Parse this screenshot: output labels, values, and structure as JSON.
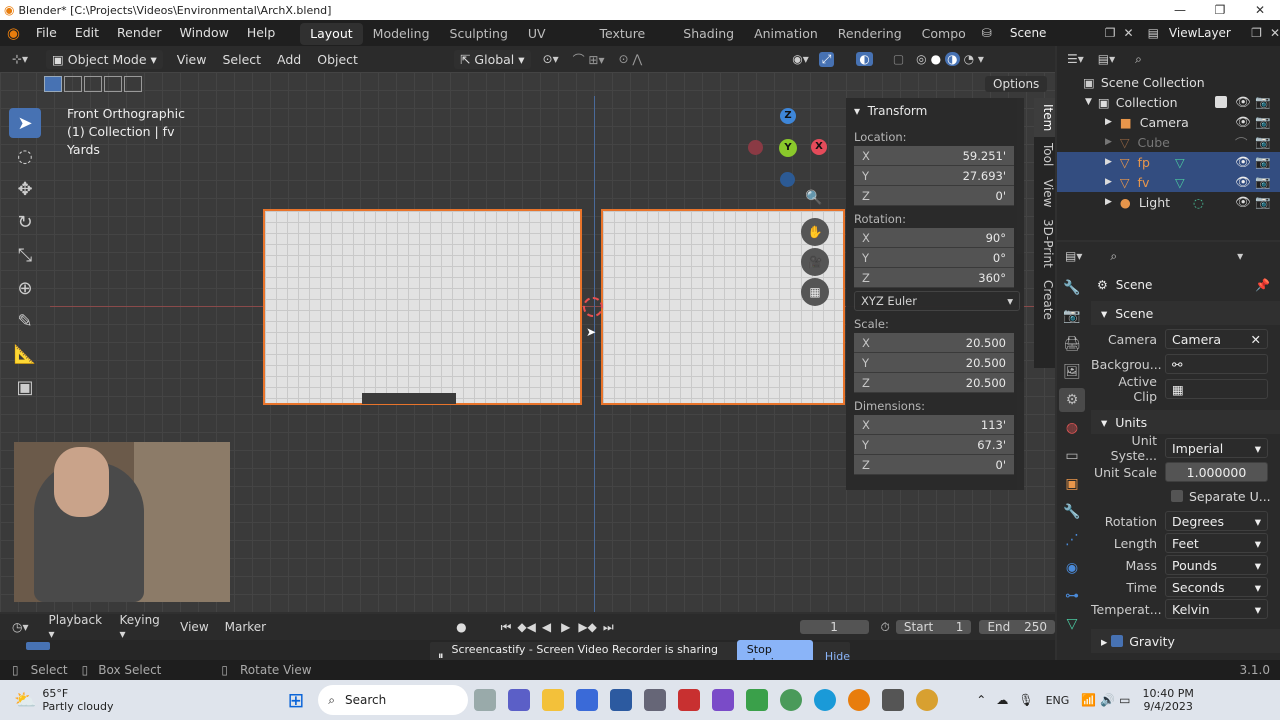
{
  "window": {
    "title": "Blender* [C:\\Projects\\Videos\\Environmental\\ArchX.blend]"
  },
  "menu": [
    "File",
    "Edit",
    "Render",
    "Window",
    "Help"
  ],
  "workspaces": [
    "Layout",
    "Modeling",
    "Sculpting",
    "UV Editing",
    "Texture Paint",
    "Shading",
    "Animation",
    "Rendering",
    "Compo"
  ],
  "scene_label": "Scene",
  "viewlayer_label": "ViewLayer",
  "header": {
    "mode": "Object Mode",
    "menus": [
      "View",
      "Select",
      "Add",
      "Object"
    ],
    "orientation": "Global",
    "options": "Options"
  },
  "viewport": {
    "view_name": "Front Orthographic",
    "collection": "(1) Collection | fv",
    "units": "Yards",
    "gizmo": {
      "z": "Z",
      "y": "Y",
      "x": "X"
    }
  },
  "npanel": {
    "tabs": [
      "Item",
      "Tool",
      "View",
      "3D-Print",
      "Create"
    ],
    "transform_label": "Transform",
    "location_label": "Location:",
    "location": [
      {
        "axis": "X",
        "value": "59.251'"
      },
      {
        "axis": "Y",
        "value": "27.693'"
      },
      {
        "axis": "Z",
        "value": "0'"
      }
    ],
    "rotation_label": "Rotation:",
    "rotation": [
      {
        "axis": "X",
        "value": "90°"
      },
      {
        "axis": "Y",
        "value": "0°"
      },
      {
        "axis": "Z",
        "value": "360°"
      }
    ],
    "rotation_mode": "XYZ Euler",
    "scale_label": "Scale:",
    "scale": [
      {
        "axis": "X",
        "value": "20.500"
      },
      {
        "axis": "Y",
        "value": "20.500"
      },
      {
        "axis": "Z",
        "value": "20.500"
      }
    ],
    "dimensions_label": "Dimensions:",
    "dimensions": [
      {
        "axis": "X",
        "value": "113'"
      },
      {
        "axis": "Y",
        "value": "67.3'"
      },
      {
        "axis": "Z",
        "value": "0'"
      }
    ]
  },
  "outliner": {
    "root": "Scene Collection",
    "collection": "Collection",
    "items": [
      {
        "name": "Camera",
        "selected": false
      },
      {
        "name": "Cube",
        "selected": false
      },
      {
        "name": "fp",
        "selected": true
      },
      {
        "name": "fv",
        "selected": true
      },
      {
        "name": "Light",
        "selected": false
      }
    ]
  },
  "properties": {
    "context": "Scene",
    "scene_section": "Scene",
    "camera_label": "Camera",
    "camera_value": "Camera",
    "background_label": "Backgrou...",
    "active_clip_label": "Active Clip",
    "units_section": "Units",
    "unit_system_label": "Unit Syste...",
    "unit_system_value": "Imperial",
    "unit_scale_label": "Unit Scale",
    "unit_scale_value": "1.000000",
    "separate_units_label": "Separate U...",
    "rotation_label": "Rotation",
    "rotation_value": "Degrees",
    "length_label": "Length",
    "length_value": "Feet",
    "mass_label": "Mass",
    "mass_value": "Pounds",
    "time_label": "Time",
    "time_value": "Seconds",
    "temperature_label": "Temperat...",
    "temperature_value": "Kelvin",
    "gravity_label": "Gravity"
  },
  "timeline": {
    "menus": [
      "Playback",
      "Keying",
      "View",
      "Marker"
    ],
    "current_frame": "1",
    "start_label": "Start",
    "start": "1",
    "end_label": "End",
    "end": "250"
  },
  "screencast": {
    "message": "Screencastify - Screen Video Recorder is sharing your screen.",
    "stop": "Stop sharing",
    "hide": "Hide"
  },
  "status": {
    "select": "Select",
    "box_select": "Box Select",
    "rotate_view": "Rotate View",
    "version": "3.1.0"
  },
  "taskbar": {
    "temp": "65°F",
    "weather": "Partly cloudy",
    "search": "Search",
    "lang": "ENG",
    "time": "10:40 PM",
    "date": "9/4/2023"
  },
  "colors": {
    "accent": "#4772b3",
    "selection_outline": "#e8742b",
    "x_axis": "#e44b5a",
    "y_axis": "#8ac82b",
    "z_axis": "#3e86d8"
  }
}
